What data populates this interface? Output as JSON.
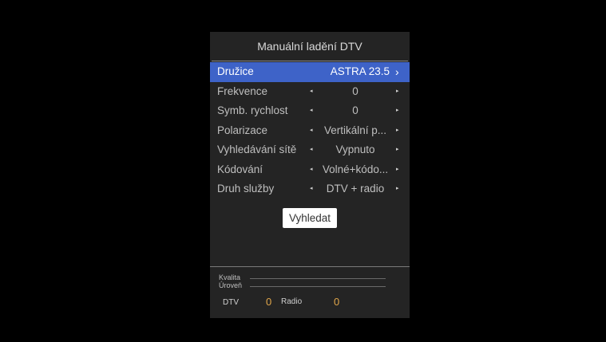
{
  "panel": {
    "title": "Manuální ladění DTV"
  },
  "menu": [
    {
      "label": "Družice",
      "value": "ASTRA 23.5",
      "chevron": "›"
    },
    {
      "label": "Frekvence",
      "value": "0"
    },
    {
      "label": "Symb. rychlost",
      "value": "0"
    },
    {
      "label": "Polarizace",
      "value": "Vertikální p..."
    },
    {
      "label": "Vyhledávání sítě",
      "value": "Vypnuto"
    },
    {
      "label": "Kódování",
      "value": "Volné+kódo..."
    },
    {
      "label": "Druh služby",
      "value": "DTV + radio"
    }
  ],
  "arrows": {
    "left": "◂",
    "right": "▸"
  },
  "search_button": "Vyhledat",
  "signal": {
    "quality_label": "Kvalita",
    "level_label": "Úroveň"
  },
  "counts": {
    "dtv_label": "DTV",
    "dtv_value": "0",
    "radio_label": "Radio",
    "radio_value": "0"
  },
  "colors": {
    "selection": "#3e63c8",
    "panel_bg": "#242424",
    "count_value": "#e0a64a"
  }
}
